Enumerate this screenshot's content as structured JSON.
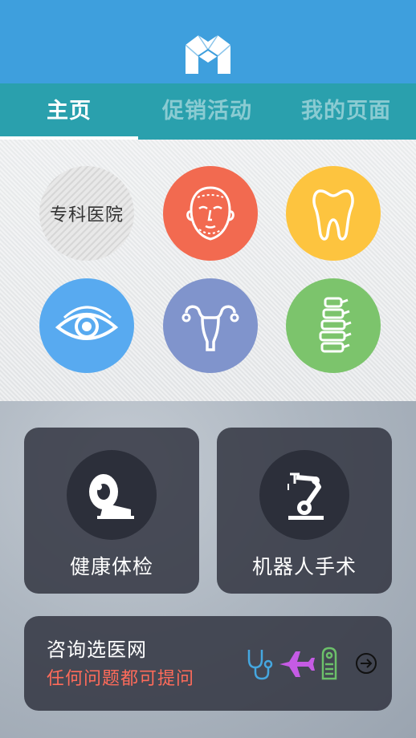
{
  "app": {
    "logo_icon": "app-logo-icon"
  },
  "tabs": [
    {
      "label": "主页",
      "active": true
    },
    {
      "label": "促销活动",
      "active": false
    },
    {
      "label": "我的页面",
      "active": false
    }
  ],
  "departments": {
    "hospital_label": "专科医院",
    "items": [
      {
        "icon": "face-icon",
        "color": "#f26a50"
      },
      {
        "icon": "tooth-icon",
        "color": "#fdc43f"
      },
      {
        "icon": "eye-icon",
        "color": "#58aaf0"
      },
      {
        "icon": "uterus-icon",
        "color": "#8094cc"
      },
      {
        "icon": "spine-icon",
        "color": "#7cc46c"
      }
    ]
  },
  "cards": {
    "checkup": {
      "label": "健康体检",
      "icon": "mri-scanner-icon"
    },
    "robot": {
      "label": "机器人手术",
      "icon": "robot-arm-icon"
    }
  },
  "consult": {
    "title": "咨询选医网",
    "subtitle": "任何问题都可提问",
    "icons": [
      "stethoscope-icon",
      "airplane-icon",
      "door-hanger-icon",
      "arrow-right-circle-icon"
    ],
    "icon_colors": [
      "#45a7e0",
      "#c55be4",
      "#6cc06a",
      "#111111"
    ]
  }
}
